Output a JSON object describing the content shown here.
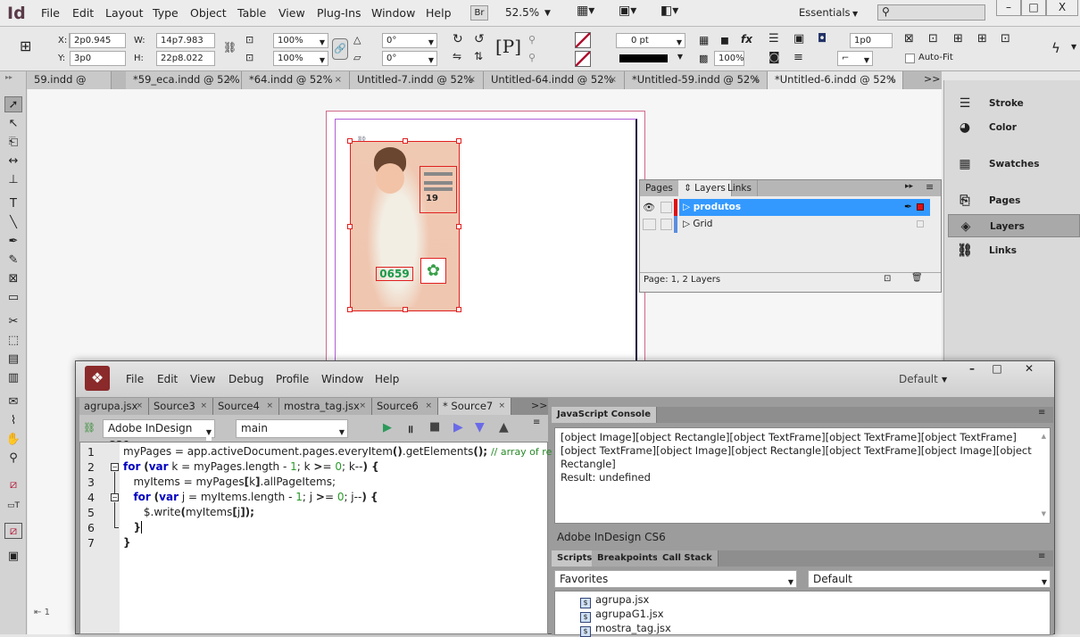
{
  "app": {
    "logo": "Id",
    "menus": [
      "File",
      "Edit",
      "Layout",
      "Type",
      "Object",
      "Table",
      "View",
      "Plug-Ins",
      "Window",
      "Help"
    ],
    "bridge": "Br",
    "zoom": "52.5%",
    "workspace": "Essentials",
    "search_placeholder": "",
    "window_buttons": [
      "–",
      "□",
      "X"
    ]
  },
  "control": {
    "x_label": "X:",
    "x": "2p0.945",
    "y_label": "Y:",
    "y": "3p0",
    "w_label": "W:",
    "w": "14p7.983",
    "h_label": "H:",
    "h": "22p8.022",
    "scale_x": "100%",
    "scale_y": "100%",
    "rotate": "0°",
    "shear": "0°",
    "stroke_weight": "0 pt",
    "opacity": "100%",
    "offset": "1p0",
    "autofit": "Auto-Fit"
  },
  "doc_tabs": [
    {
      "label": "59.indd @ 52%"
    },
    {
      "label": "*59_eca.indd @ 52%"
    },
    {
      "label": "*64.indd @ 52%"
    },
    {
      "label": "Untitled-7.indd @ 52%"
    },
    {
      "label": "Untitled-64.indd @ 52%"
    },
    {
      "label": "*Untitled-59.indd @ 52%"
    },
    {
      "label": "*Untitled-6.indd @ 52%",
      "active": true
    }
  ],
  "doc_tabs_more": ">>",
  "photo": {
    "price_text": "19",
    "code_text": "0659"
  },
  "layers_panel": {
    "tabs": [
      "Pages",
      "Layers",
      "Links"
    ],
    "layers": [
      {
        "name": "produtos",
        "color": "#e01010",
        "selected": true,
        "visible": true
      },
      {
        "name": "Grid",
        "color": "#5a8ee0",
        "selected": false,
        "visible": false
      }
    ],
    "status": "Page: 1, 2 Layers"
  },
  "dock": {
    "items": [
      {
        "label": "Stroke",
        "icon": "stroke-icon"
      },
      {
        "label": "Color",
        "icon": "color-icon"
      },
      {
        "label": "Swatches",
        "icon": "swatches-icon"
      },
      {
        "label": "Pages",
        "icon": "pages-icon"
      },
      {
        "label": "Layers",
        "icon": "layers-icon",
        "selected": true
      },
      {
        "label": "Links",
        "icon": "links-icon"
      }
    ]
  },
  "estk": {
    "menus": [
      "File",
      "Edit",
      "View",
      "Debug",
      "Profile",
      "Window",
      "Help"
    ],
    "workspace": "Default",
    "window_buttons": [
      "–",
      "□",
      "✕"
    ],
    "source_tabs": [
      {
        "label": "agrupa.jsx"
      },
      {
        "label": "Source3"
      },
      {
        "label": "Source4"
      },
      {
        "label": "mostra_tag.jsx"
      },
      {
        "label": "Source6"
      },
      {
        "label": "* Source7",
        "active": true
      }
    ],
    "source_tabs_more": ">>",
    "target": "Adobe InDesign CS6",
    "function": "main",
    "code_line_numbers": [
      "1",
      "2",
      "3",
      "4",
      "5",
      "6",
      "7"
    ],
    "console_tab": "JavaScript Console",
    "console_output": "[object Image][object Rectangle][object TextFrame][object TextFrame][object TextFrame][object TextFrame][object Image][object Rectangle][object TextFrame][object Image][object Rectangle]",
    "console_result": "Result: undefined",
    "target_status": "Adobe InDesign CS6",
    "bottom_tabs": [
      "Scripts",
      "Breakpoints",
      "Call Stack"
    ],
    "scripts_location": "Favorites",
    "scripts_engine": "Default",
    "scripts": [
      "agrupa.jsx",
      "agrupaG1.jsx",
      "mostra_tag.jsx"
    ]
  },
  "toolbox_page": "1",
  "colors": {
    "selection": "#e02020",
    "layer_highlight": "#3399ff",
    "code_keyword": "#0000c0",
    "code_number": "#2a9a2a",
    "code_comment": "#2a8a2a"
  }
}
